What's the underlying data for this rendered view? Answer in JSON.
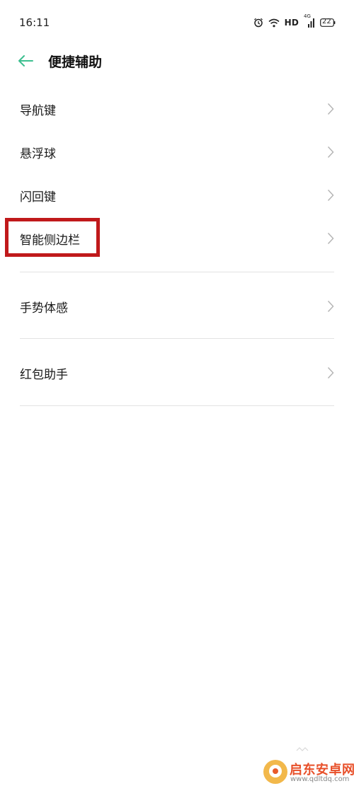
{
  "status_bar": {
    "time": "16:11",
    "network_label": "HD",
    "signal_label": "4G",
    "battery_level": "22"
  },
  "header": {
    "back_icon": "arrow-left-icon",
    "title": "便捷辅助",
    "accent_color": "#3cbf8f"
  },
  "list_group_1": [
    {
      "label": "导航键"
    },
    {
      "label": "悬浮球"
    },
    {
      "label": "闪回键"
    },
    {
      "label": "智能侧边栏"
    }
  ],
  "list_group_2": [
    {
      "label": "手势体感"
    }
  ],
  "list_group_3": [
    {
      "label": "红包助手"
    }
  ],
  "highlight": {
    "target": "智能侧边栏",
    "color": "#c0191b"
  },
  "watermark": {
    "name": "启东安卓网",
    "url": "www.qdltdq.com"
  }
}
